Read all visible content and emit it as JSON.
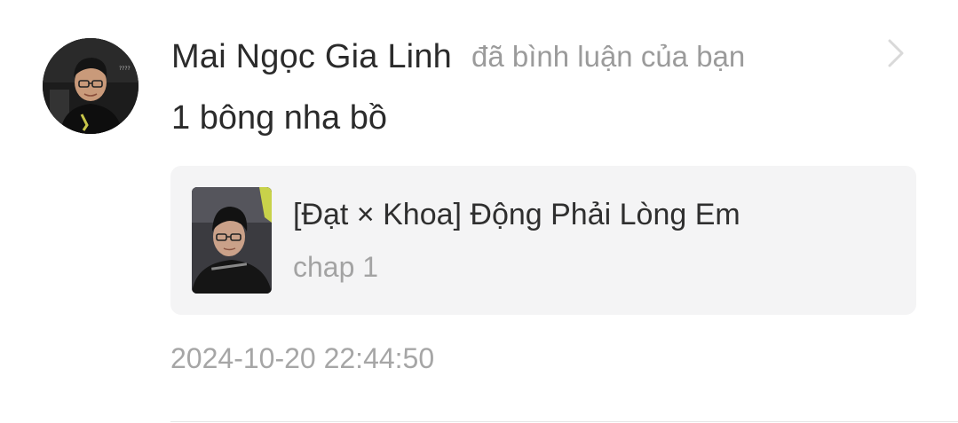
{
  "notification": {
    "user_name": "Mai Ngọc Gia Linh",
    "action_text": "đã bình luận của bạn",
    "comment_text": "1 bông nha bồ",
    "timestamp": "2024-10-20 22:44:50",
    "avatar_icon": "user-avatar-photo",
    "chevron_icon": "chevron-right-icon",
    "linked_content": {
      "title": "[Đạt × Khoa] Động Phải Lòng Em",
      "subtitle": "chap 1",
      "thumbnail_icon": "story-cover-photo"
    }
  },
  "colors": {
    "background": "#ffffff",
    "primary_text": "#2b2b2b",
    "secondary_text": "#9b9b9b",
    "card_background": "#f4f4f5",
    "chevron": "#d9d9d9"
  }
}
